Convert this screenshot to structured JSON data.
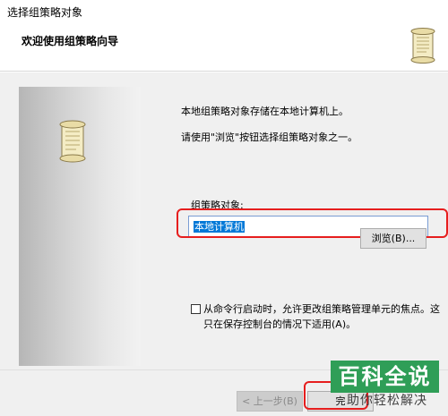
{
  "window": {
    "title": "选择组策略对象"
  },
  "header": {
    "title": "欢迎使用组策略向导"
  },
  "main": {
    "line1": "本地组策略对象存储在本地计算机上。",
    "line2": "请使用\"浏览\"按钮选择组策略对象之一。",
    "gpo_label": "组策略对象:",
    "gpo_value": "本地计算机",
    "browse_label": "浏览(B)...",
    "checkbox_label": "从命令行启动时，允许更改组策略管理单元的焦点。这只在保存控制台的情况下适用(A)。",
    "checkbox_checked": false
  },
  "footer": {
    "back_label": "< 上一步(B)",
    "finish_label": "完"
  },
  "watermark": {
    "title": "百科全说",
    "subtitle": "助你轻松解决"
  },
  "colors": {
    "highlight_red": "#e61e1e",
    "selection_blue": "#0078d7",
    "watermark_green": "#2f9e57"
  }
}
